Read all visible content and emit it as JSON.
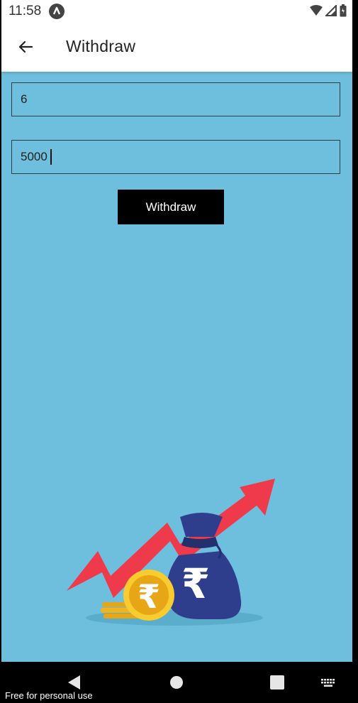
{
  "status_bar": {
    "time": "11:58",
    "app_icon": "app-notification-icon",
    "wifi_icon": "wifi-icon",
    "signal_icon": "cellular-signal-icon",
    "battery_icon": "battery-icon"
  },
  "app_bar": {
    "title": "Withdraw",
    "back_icon": "arrow-left-icon"
  },
  "form": {
    "field_1_value": "6",
    "field_2_value": "5000",
    "submit_label": "Withdraw"
  },
  "illustration": {
    "description_icons": [
      "trend-arrow-icon",
      "money-bag-icon",
      "rupee-coin-icon"
    ],
    "bag_symbol": "₹",
    "coin_symbol": "₹"
  },
  "nav_bar": {
    "back_icon": "nav-back-icon",
    "home_icon": "nav-home-icon",
    "recents_icon": "nav-recents-icon",
    "keyboard_icon": "keyboard-icon"
  },
  "watermark": "Free for personal use",
  "colors": {
    "background": "#6ebfdd",
    "button": "#000000",
    "arrow": "#ee3a4a",
    "bag": "#2e3e8c",
    "coin": "#f2b418"
  }
}
